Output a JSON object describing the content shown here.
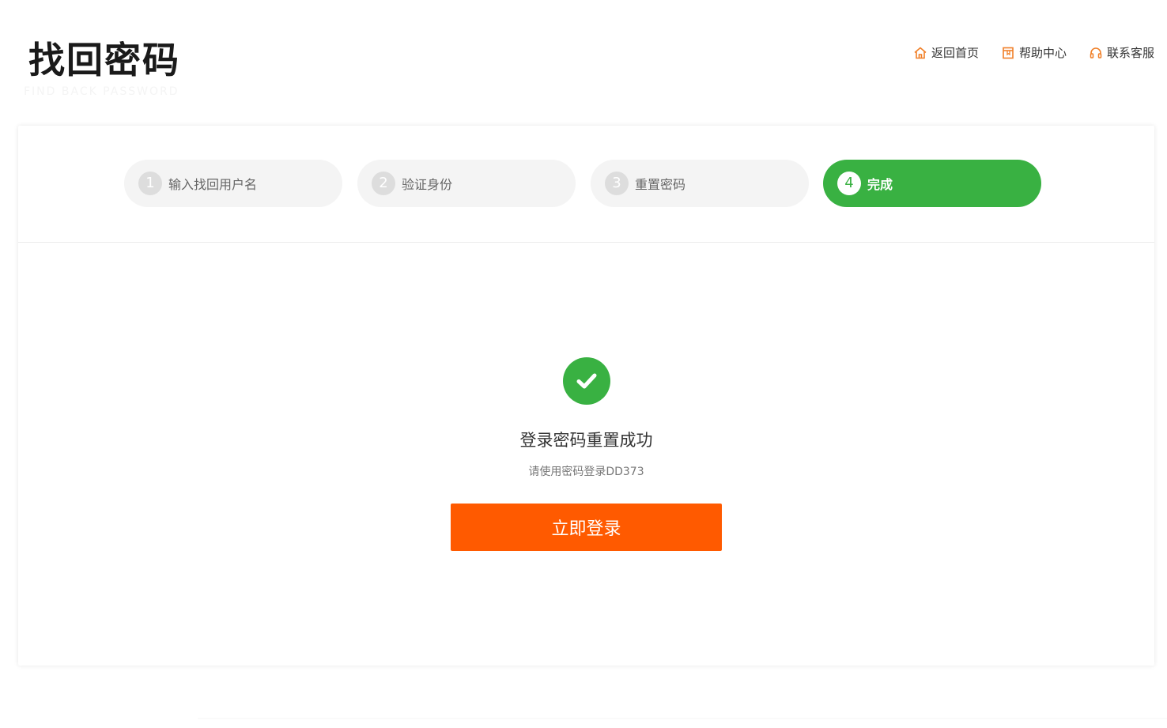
{
  "header": {
    "title": "找回密码",
    "subtitle": "FIND BACK PASSWORD",
    "links": [
      {
        "label": "返回首页",
        "icon": "home-icon"
      },
      {
        "label": "帮助中心",
        "icon": "help-book-icon"
      },
      {
        "label": "联系客服",
        "icon": "headset-icon"
      }
    ]
  },
  "steps": [
    {
      "num": "1",
      "label": "输入找回用户名",
      "active": false
    },
    {
      "num": "2",
      "label": "验证身份",
      "active": false
    },
    {
      "num": "3",
      "label": "重置密码",
      "active": false
    },
    {
      "num": "4",
      "label": "完成",
      "active": true
    }
  ],
  "result": {
    "icon": "check-circle-icon",
    "title": "登录密码重置成功",
    "hint": "请使用密码登录DD373",
    "button_label": "立即登录"
  },
  "colors": {
    "accent_orange": "#ff5a00",
    "success_green": "#39b142",
    "link_icon_orange": "#f07f27"
  }
}
